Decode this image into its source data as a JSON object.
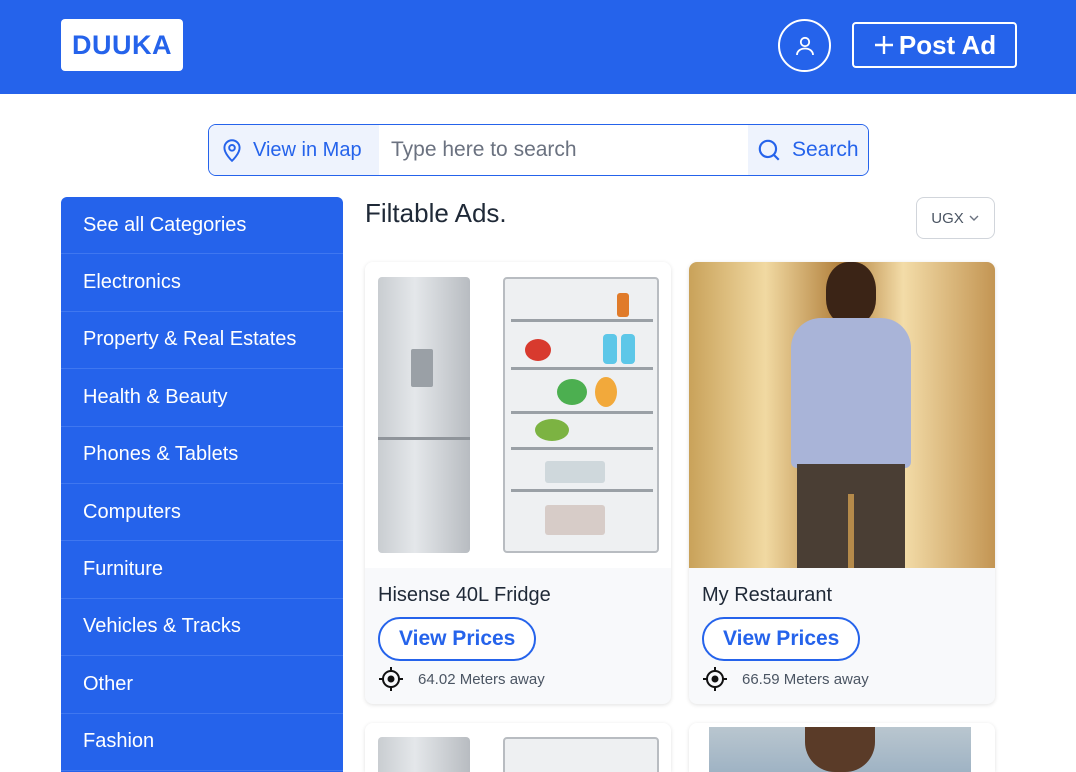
{
  "header": {
    "logo": "DUUKA",
    "post_ad_label": "Post Ad",
    "icons": {
      "user": "user-icon",
      "plus": "plus-icon"
    }
  },
  "search": {
    "map_label": "View in Map",
    "placeholder": "Type here to search",
    "button_label": "Search",
    "icons": {
      "map": "map-pin-icon",
      "search": "search-icon"
    }
  },
  "sidebar": {
    "items": [
      {
        "label": "See all Categories"
      },
      {
        "label": "Electronics"
      },
      {
        "label": "Property & Real Estates"
      },
      {
        "label": "Health & Beauty"
      },
      {
        "label": "Phones & Tablets"
      },
      {
        "label": "Computers"
      },
      {
        "label": "Furniture"
      },
      {
        "label": "Vehicles & Tracks"
      },
      {
        "label": "Other"
      },
      {
        "label": "Fashion"
      }
    ]
  },
  "main": {
    "title": "Filtable Ads.",
    "currency": "UGX",
    "ads": [
      {
        "title": "Hisense 40L Fridge",
        "button": "View Prices",
        "distance": "64.02 Meters away"
      },
      {
        "title": "My Restaurant",
        "button": "View Prices",
        "distance": "66.59 Meters away"
      }
    ]
  },
  "colors": {
    "primary": "#2563eb",
    "background": "#ffffff",
    "card": "#f8f9fb"
  }
}
